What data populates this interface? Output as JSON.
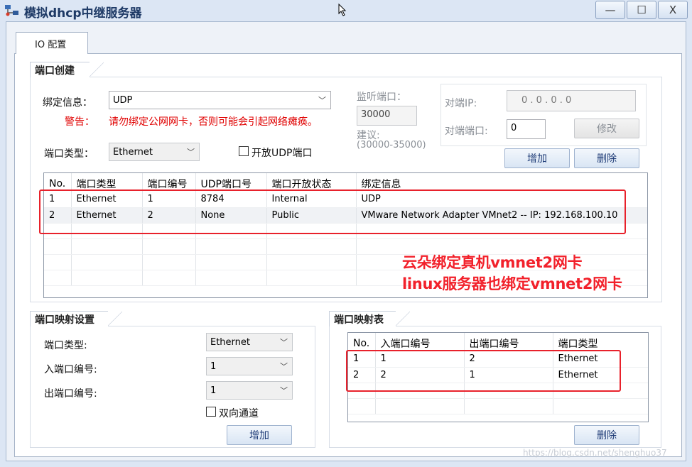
{
  "window": {
    "title": "模拟dhcp中继服务器",
    "controls": {
      "minimize": "—",
      "maximize": "☐",
      "close": "X"
    }
  },
  "tabs": [
    {
      "label": "IO 配置"
    }
  ],
  "port_create": {
    "title": "端口创建",
    "bind_label": "绑定信息：",
    "bind_value": "UDP",
    "warning_label": "警告：",
    "warning_text": "请勿绑定公网网卡，否则可能会引起网络瘫痪。",
    "port_type_label": "端口类型：",
    "port_type_value": "Ethernet",
    "open_udp_label": "开放UDP端口",
    "listen_port_label": "监听端口：",
    "listen_port_value": "30000",
    "suggest_label": "建议:",
    "suggest_range": "(30000-35000)",
    "peer_ip_label": "对端IP:",
    "peer_ip_value": "0  .  0  .  0  .  0",
    "peer_port_label": "对端端口:",
    "peer_port_value": "0",
    "modify_button": "修改",
    "add_button": "增加",
    "delete_button": "删除",
    "table": {
      "headers": [
        "No.",
        "端口类型",
        "端口编号",
        "UDP端口号",
        "端口开放状态",
        "绑定信息"
      ],
      "rows": [
        [
          "1",
          "Ethernet",
          "1",
          "8784",
          "Internal",
          "UDP"
        ],
        [
          "2",
          "Ethernet",
          "2",
          "None",
          "Public",
          "VMware Network Adapter VMnet2 -- IP: 192.168.100.10"
        ]
      ]
    }
  },
  "port_map_settings": {
    "title": "端口映射设置",
    "port_type_label": "端口类型:",
    "port_type_value": "Ethernet",
    "in_port_label": "入端口编号:",
    "in_port_value": "1",
    "out_port_label": "出端口编号:",
    "out_port_value": "1",
    "bidirectional_label": "双向通道",
    "add_button": "增加"
  },
  "port_map_table": {
    "title": "端口映射表",
    "headers": [
      "No.",
      "入端口编号",
      "出端口编号",
      "端口类型"
    ],
    "rows": [
      [
        "1",
        "1",
        "2",
        "Ethernet"
      ],
      [
        "2",
        "2",
        "1",
        "Ethernet"
      ]
    ],
    "delete_button": "删除"
  },
  "annotations": {
    "line1": "云朵绑定真机vmnet2网卡",
    "line2": "linux服务器也绑定vmnet2网卡"
  },
  "watermark": "https://blog.csdn.net/shenghuo37",
  "colors": {
    "accent": "#1f3c77",
    "warning": "#e00000",
    "annotation": "#f2212b",
    "window_bg": "#dce6f4"
  }
}
